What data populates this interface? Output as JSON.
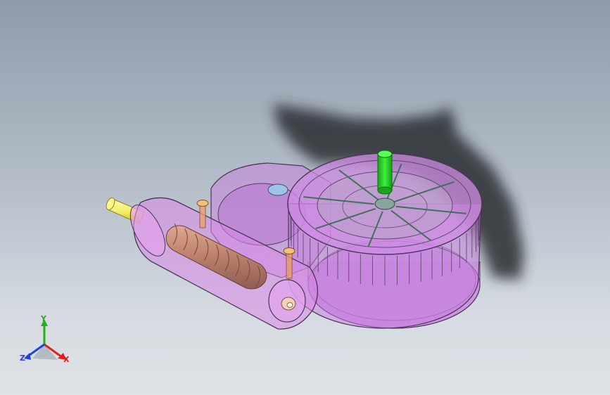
{
  "viewport": {
    "background_top": "#8f9bab",
    "background_bottom": "#dfe3e7"
  },
  "model": {
    "housing_color": "#c77adf",
    "gear_color": "#b9a3c9",
    "worm_color": "#c98f7a",
    "input_shaft_color": "#f4ee6a",
    "output_shaft_color": "#22d422",
    "bolt_color": "#e8a070",
    "shadow_color": "#2a2e33"
  },
  "triad": {
    "x_label": "X",
    "y_label": "Y",
    "z_label": "Z",
    "x_color": "#e02020",
    "y_color": "#20b020",
    "z_color": "#2040e0"
  }
}
